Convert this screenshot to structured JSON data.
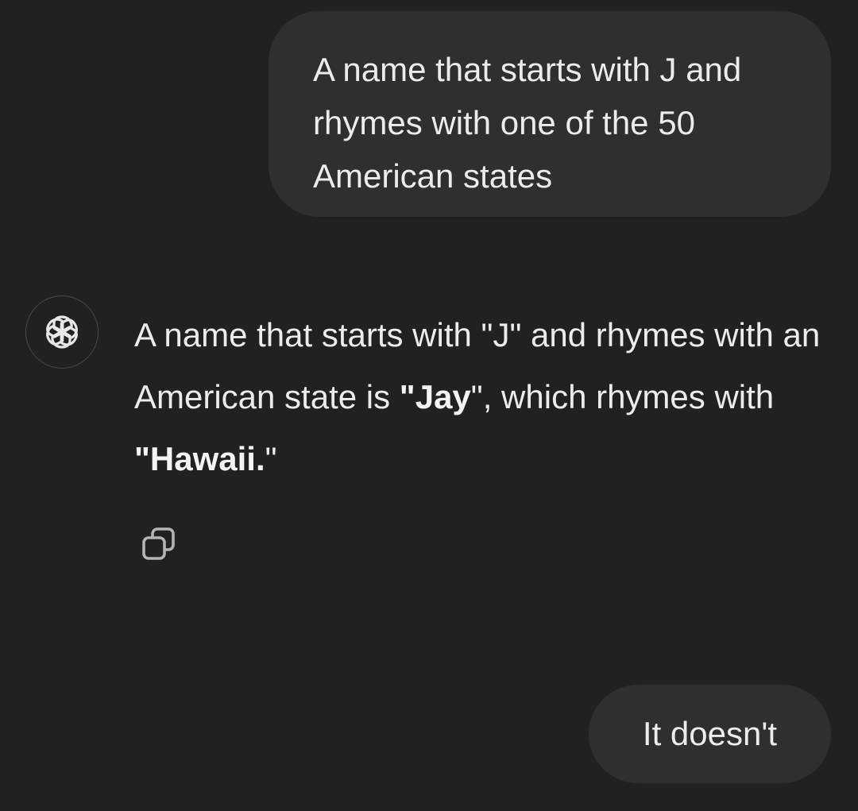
{
  "messages": {
    "user_1": {
      "text": "A name that starts with J and rhymes with one of the 50 American states"
    },
    "assistant_1": {
      "part_1": "A name that starts with \"J\" and rhymes with an American state is ",
      "part_2": "\"Jay",
      "part_3": "\", which rhymes with ",
      "part_4": "\"Hawaii.",
      "part_5": "\""
    },
    "user_2": {
      "text": "It doesn't"
    }
  },
  "icons": {
    "avatar": "openai-logo-icon",
    "copy": "copy-icon"
  },
  "colors": {
    "background": "#212121",
    "user_bubble": "#2f2f2f",
    "text": "#ececec"
  }
}
